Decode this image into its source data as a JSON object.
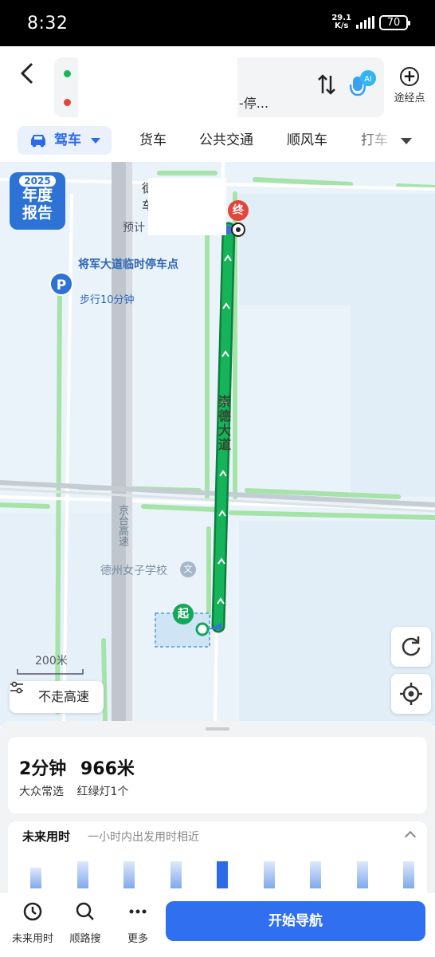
{
  "status_bar": {
    "time": "8:32",
    "net_speed_value": "29.1",
    "net_speed_unit": "K/s",
    "battery": "70"
  },
  "header": {
    "start_text": "",
    "end_text": "-停...",
    "waypoint_label": "途经点",
    "ai_label": "AI"
  },
  "modes": {
    "active": "驾车",
    "tabs": [
      "货车",
      "公共交通",
      "顺风车",
      "打车"
    ]
  },
  "map": {
    "report_year": "2025",
    "report_line1": "年度",
    "report_line2": "报告",
    "road_main": "崇德大道",
    "highway": "京台高速",
    "parking_icon": "P",
    "parking_name": "将军大道临时停车点",
    "parking_walk": "步行10分钟",
    "school": "德州女子学校",
    "end_pin": "终",
    "start_pin": "起",
    "estimate_prefix": "预计",
    "partial_char_1": "德",
    "partial_char_2": "车",
    "scale": "200米",
    "avoid_highway": "不走高速"
  },
  "route": {
    "duration": "2分钟",
    "distance": "966米",
    "tag": "大众常选",
    "traffic_lights": "红绿灯1个"
  },
  "future": {
    "title": "未来用时",
    "subtitle": "一小时内出发用时相近",
    "bars": [
      0.55,
      0.7,
      0.7,
      0.7,
      0.7,
      0.7,
      0.7,
      0.7,
      0.7
    ],
    "active_index": 4
  },
  "bottom_nav": {
    "future_time": "未来用时",
    "along_search": "顺路搜",
    "more": "更多",
    "start_navigation": "开始导航"
  },
  "colors": {
    "route": "#16b45a",
    "accent": "#2f6ff0",
    "start": "#13a75a",
    "end": "#e5443b"
  }
}
